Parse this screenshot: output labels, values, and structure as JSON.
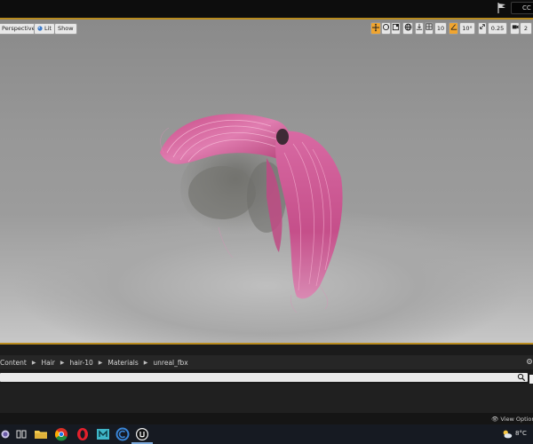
{
  "top_bar": {
    "button_label": "CC"
  },
  "viewport": {
    "perspective_label": "Perspective",
    "lit_label": "Lit",
    "show_label": "Show",
    "grid_snap_value": "10",
    "rotation_snap_value": "10°",
    "scale_snap_value": "0.25",
    "camera_speed_value": "2"
  },
  "content_browser": {
    "breadcrumbs": [
      "Content",
      "Hair",
      "hair-10",
      "Materials",
      "unreal_fbx"
    ],
    "view_options_label": "View Options"
  },
  "taskbar": {
    "temperature": "8°C",
    "apps": [
      "search-icon",
      "task-view-icon",
      "file-explorer-icon",
      "chrome-icon",
      "opera-icon",
      "media-player-icon",
      "ccleaner-icon",
      "unreal-engine-icon"
    ]
  },
  "colors": {
    "viewport_border": "#b88b1e",
    "active_toolbar_button": "#f0a530",
    "hair_pink": "#d05a92"
  }
}
